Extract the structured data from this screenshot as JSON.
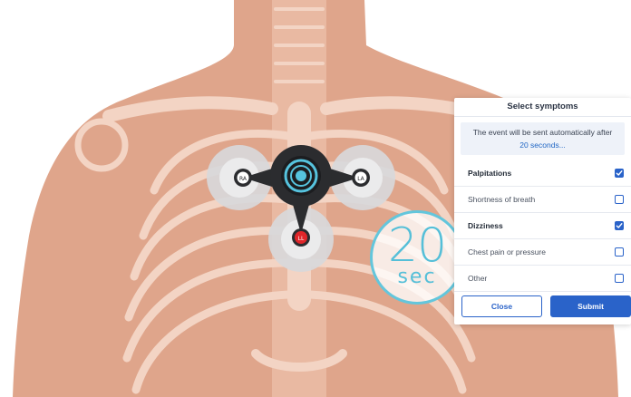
{
  "timer": {
    "value": "20",
    "unit": "sec"
  },
  "device": {
    "left_electrode": "RA",
    "right_electrode": "LA",
    "bottom_electrode": "LL"
  },
  "panel": {
    "title": "Select symptoms",
    "notice_line1": "The event will be sent automatically after",
    "notice_line2": "20 seconds...",
    "symptoms": [
      {
        "label": "Palpitations",
        "checked": true
      },
      {
        "label": "Shortness of breath",
        "checked": false
      },
      {
        "label": "Dizziness",
        "checked": true
      },
      {
        "label": "Chest pain or pressure",
        "checked": false
      },
      {
        "label": "Other",
        "checked": false
      }
    ],
    "close_label": "Close",
    "submit_label": "Submit"
  },
  "colors": {
    "accent": "#2a63c9",
    "timer": "#63c6dc",
    "skin": "#dfa58b",
    "alert_electrode": "#e0262a"
  }
}
